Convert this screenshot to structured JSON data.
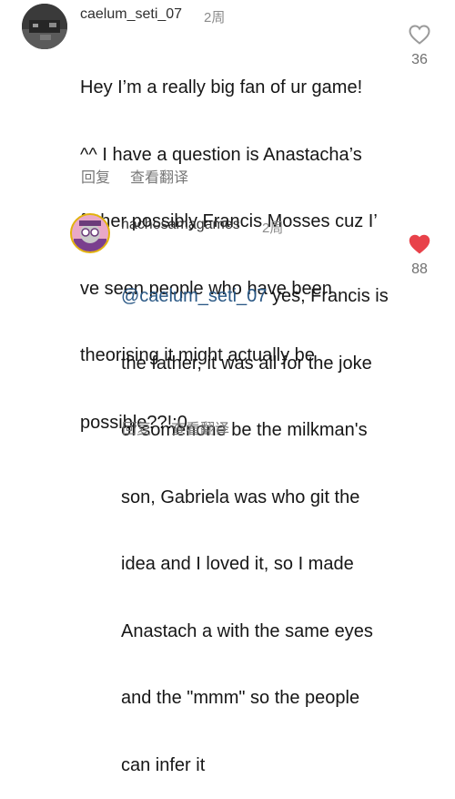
{
  "comment": {
    "username": "caelum_seti_07",
    "time": "2周",
    "text_lines": [
      "Hey I’m a really big fan of ur game!",
      "^^ I have a question is Anastacha’s",
      "father possibly Francis Mosses cuz I’",
      "ve seen people who have been",
      "theorising it might actually be",
      "possible??!:0"
    ],
    "like_count": "36",
    "liked": false,
    "reply_label": "回复",
    "translate_label": "查看翻译"
  },
  "reply": {
    "username": "nachosamagames",
    "time": "2周",
    "mention": "@caelum_seti_07",
    "first_line_rest": " yes, Francis is",
    "text_lines": [
      "the father, it was all for the joke",
      "of somenone be the milkman's",
      "son, Gabriela was who git the",
      "idea and I loved it, so I made",
      "Anastach a with the same eyes",
      "and the \"mmm\" so the people",
      "can infer it"
    ],
    "like_count": "88",
    "liked": true,
    "reply_label": "回复",
    "translate_label": "查看翻译"
  },
  "colors": {
    "liked_heart": "#e8424a",
    "mention": "#2a5885"
  },
  "icons": {
    "like": "heart-icon"
  }
}
